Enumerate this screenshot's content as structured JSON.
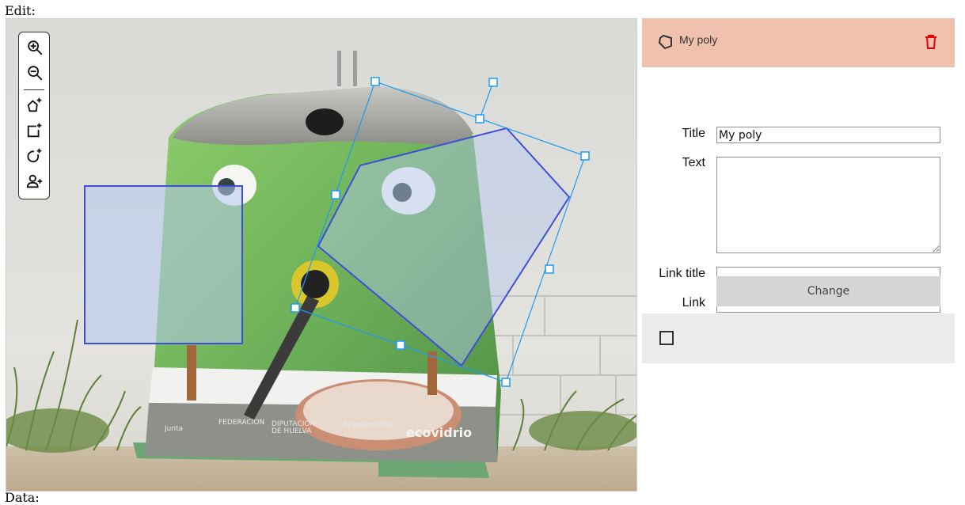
{
  "labels": {
    "edit": "Edit:",
    "data": "Data:"
  },
  "toolbar": {
    "tools": [
      {
        "icon": "zoom-in-icon",
        "name": "zoom-in"
      },
      {
        "icon": "zoom-out-icon",
        "name": "zoom-out"
      },
      {
        "icon": "add-polygon-icon",
        "name": "add-polygon"
      },
      {
        "icon": "add-rectangle-icon",
        "name": "add-rectangle"
      },
      {
        "icon": "add-circle-icon",
        "name": "add-circle"
      },
      {
        "icon": "add-person-icon",
        "name": "add-person"
      }
    ]
  },
  "shapes": [
    {
      "type": "rectangle",
      "selected": false
    },
    {
      "type": "polygon",
      "title": "My poly",
      "selected": true
    }
  ],
  "panel": {
    "selected_item": {
      "icon": "polygon-icon",
      "name": "My poly",
      "delete_icon": "trash-icon"
    },
    "form": {
      "title_label": "Title",
      "title_value": "My poly",
      "text_label": "Text",
      "text_value": "",
      "link_title_label": "Link title",
      "link_title_value": "",
      "link_label": "Link",
      "link_value": "",
      "change_button": "Change"
    },
    "second_item": {
      "icon": "rectangle-icon"
    }
  },
  "colors": {
    "selected_header_bg": "#f0c2ad",
    "delete_icon": "#e8000b",
    "shape_fill": "#b4c8f0",
    "shape_stroke": "#3d4fd6",
    "handle_stroke": "#1e9bf0",
    "button_bg": "#d5d5d5",
    "second_item_bg": "#ebebeb"
  }
}
